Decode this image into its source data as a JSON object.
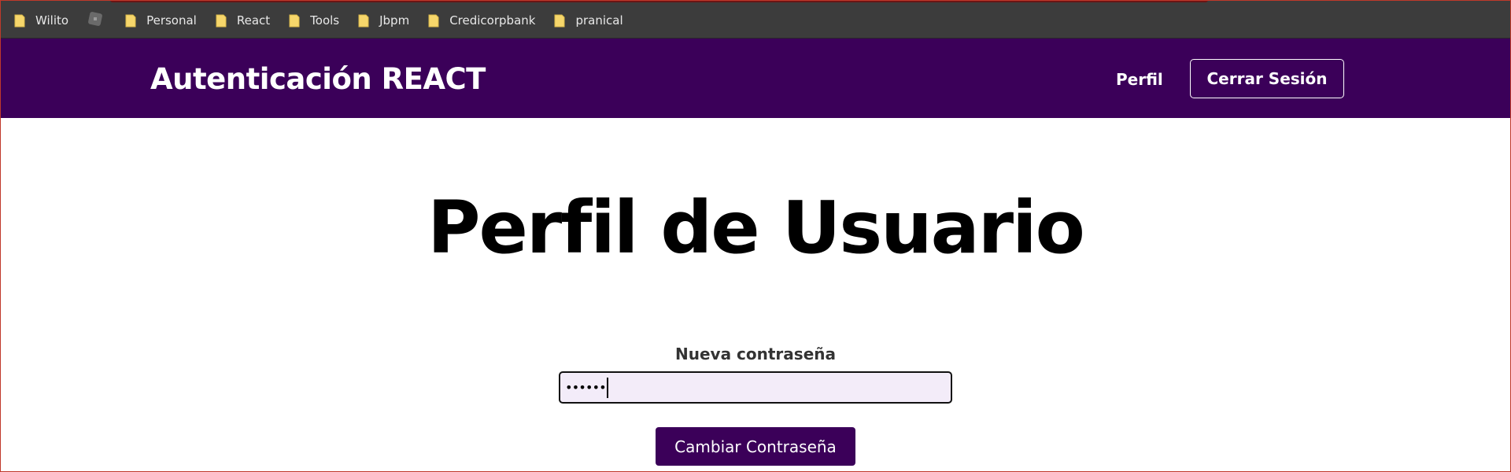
{
  "bookmarks_bar": {
    "items": [
      {
        "label": "Wilito",
        "icon": "folder-icon"
      },
      {
        "label": "",
        "icon": "site-icon"
      },
      {
        "label": "Personal",
        "icon": "folder-icon"
      },
      {
        "label": "React",
        "icon": "folder-icon"
      },
      {
        "label": "Tools",
        "icon": "folder-icon"
      },
      {
        "label": "Jbpm",
        "icon": "folder-icon"
      },
      {
        "label": "Credicorpbank",
        "icon": "folder-icon"
      },
      {
        "label": "pranical",
        "icon": "folder-icon"
      }
    ]
  },
  "header": {
    "brand": "Autenticación REACT",
    "nav_profile": "Perfil",
    "logout_label": "Cerrar Sesión"
  },
  "main": {
    "title": "Perfil de Usuario",
    "new_password_label": "Nueva contraseña",
    "password_value_masked": "••••••",
    "submit_label": "Cambiar Contraseña"
  },
  "colors": {
    "brand_purple": "#3b0059",
    "bookmarks_bg": "#3c3c3c",
    "input_bg": "#f3ecf9",
    "folder_yellow": "#f6d66b"
  }
}
